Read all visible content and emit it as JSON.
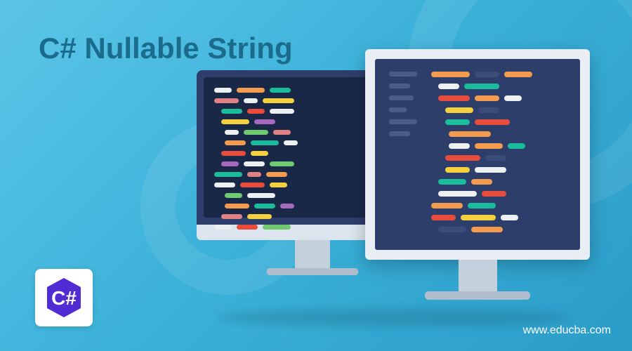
{
  "title": "C# Nullable String",
  "website": "www.educba.com",
  "logo": {
    "language": "C#",
    "color": "#512bd4"
  }
}
